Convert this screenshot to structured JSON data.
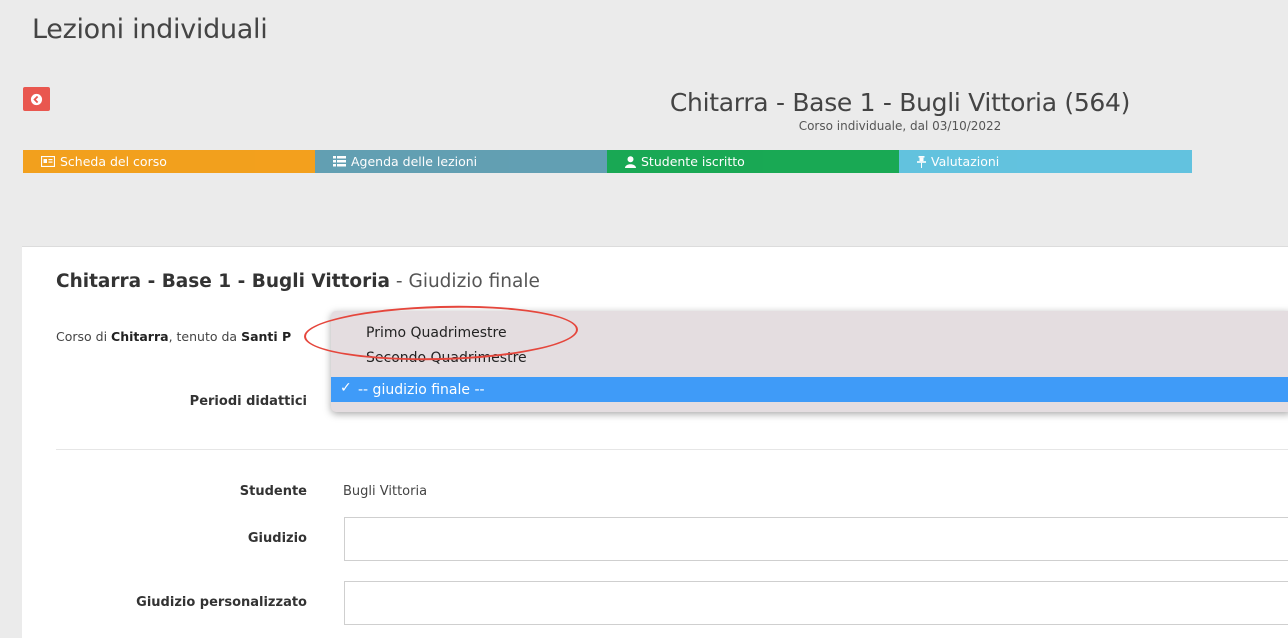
{
  "page": {
    "title": "Lezioni individuali"
  },
  "course": {
    "title": "Chitarra - Base 1 - Bugli Vittoria (564)",
    "subtitle": "Corso individuale, dal 03/10/2022"
  },
  "tabs": [
    {
      "label": "Scheda del corso",
      "color": "#f39c12",
      "icon": "id-card-icon"
    },
    {
      "label": "Agenda delle lezioni",
      "color": "#5b9bb0",
      "icon": "list-icon"
    },
    {
      "label": "Studente iscritto",
      "color": "#0ea54c",
      "icon": "user-icon"
    },
    {
      "label": "Valutazioni",
      "color": "#5bc0de",
      "icon": "pin-icon"
    }
  ],
  "evaluation": {
    "title_bold": "Chitarra - Base 1 - Bugli Vittoria",
    "title_rest": " - Giudizio finale",
    "desc_prefix": "Corso di ",
    "desc_subject": "Chitarra",
    "desc_middle": ", tenuto da ",
    "desc_teacher": "Santi P"
  },
  "form": {
    "period_label": "Periodi didattici",
    "period_options": [
      "Primo Quadrimestre",
      "Secondo Quadrimestre",
      "-- giudizio finale --"
    ],
    "period_selected": "-- giudizio finale --",
    "student_label": "Studente",
    "student_value": "Bugli Vittoria",
    "judgement_label": "Giudizio",
    "judgement_value": "",
    "custom_judgement_label": "Giudizio personalizzato",
    "custom_judgement_value": ""
  },
  "colors": {
    "danger": "#e9574f",
    "highlight": "#3f9bf8",
    "annotation": "#e5463c"
  }
}
